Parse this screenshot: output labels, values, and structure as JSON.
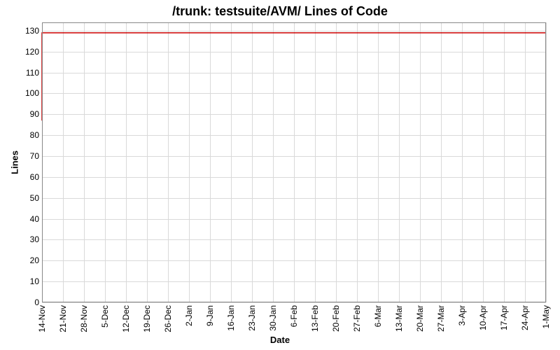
{
  "chart_data": {
    "type": "line",
    "title": "/trunk: testsuite/AVM/ Lines of Code",
    "xlabel": "Date",
    "ylabel": "Lines",
    "ylim": [
      0,
      134
    ],
    "y_ticks": [
      0,
      10,
      20,
      30,
      40,
      50,
      60,
      70,
      80,
      90,
      100,
      110,
      120,
      130
    ],
    "x_categories": [
      "14-Nov",
      "21-Nov",
      "28-Nov",
      "5-Dec",
      "12-Dec",
      "19-Dec",
      "26-Dec",
      "2-Jan",
      "9-Jan",
      "16-Jan",
      "23-Jan",
      "30-Jan",
      "6-Feb",
      "13-Feb",
      "20-Feb",
      "27-Feb",
      "6-Mar",
      "13-Mar",
      "20-Mar",
      "27-Mar",
      "3-Apr",
      "10-Apr",
      "17-Apr",
      "24-Apr",
      "1-May"
    ],
    "series": [
      {
        "name": "Lines of Code",
        "color": "#cc0000",
        "x": [
          "14-Nov",
          "14-Nov",
          "1-May"
        ],
        "values": [
          87,
          129,
          129
        ]
      }
    ]
  }
}
